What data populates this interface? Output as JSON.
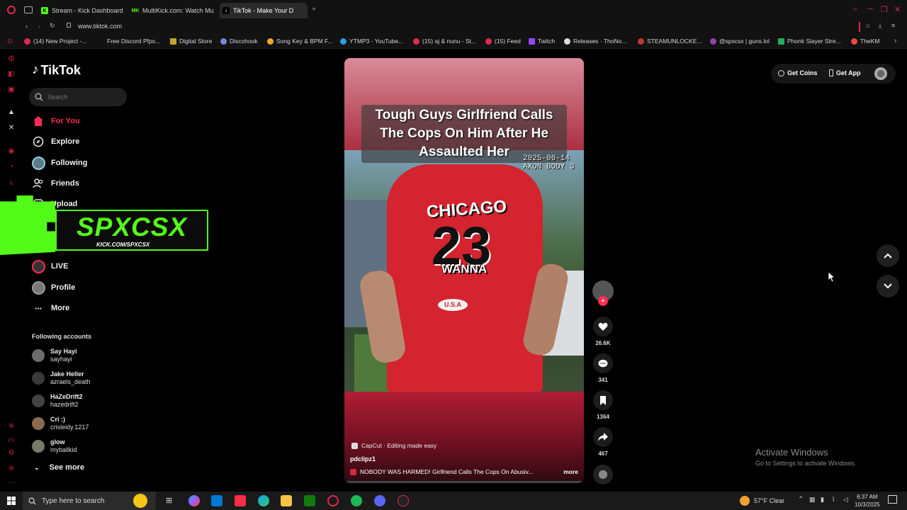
{
  "browser": {
    "tabs": [
      {
        "label": "Stream - Kick Dashboard",
        "fav": "K",
        "color": "#53fc18"
      },
      {
        "label": "MultiKick.com: Watch Mu",
        "fav": "MK",
        "color": "#53fc18"
      },
      {
        "label": "TikTok - Make Your D",
        "fav": "♪",
        "color": "#ffffff"
      }
    ],
    "url": "www.tiktok.com",
    "bookmarks": [
      "(14) New Project -...",
      "Free Discord Pfps...",
      "Digital Store",
      "Discohook",
      "Song Key & BPM F...",
      "YTMP3 - YouTube...",
      "(15) aj & nunu - St...",
      "(15) Feed",
      "Twitch",
      "Releases · ThoNo...",
      "STEAMUNLOCKE...",
      "@spxcsx | guns.lol",
      "Phonk Slayer Stre...",
      "TheKM"
    ]
  },
  "tiktok": {
    "logo": "TikTok",
    "search_placeholder": "Search",
    "nav": {
      "for_you": "For You",
      "explore": "Explore",
      "following": "Following",
      "friends": "Friends",
      "upload": "Upload",
      "live": "LIVE",
      "profile": "Profile",
      "more": "More"
    },
    "following_header": "Following accounts",
    "following_accounts": [
      {
        "name": "Say Hayi",
        "user": "sayhayi"
      },
      {
        "name": "Jake Heller",
        "user": "azraels_death"
      },
      {
        "name": "HaZeDrift2",
        "user": "hazedrift2"
      },
      {
        "name": "Cri :)",
        "user": "crisleidy.1217"
      },
      {
        "name": "glow",
        "user": "myballkid"
      }
    ],
    "see_more": "See more",
    "get_coins": "Get Coins",
    "get_app": "Get App"
  },
  "overlay": {
    "name": "SPXCSX",
    "url": "KICK.COM/SPXCSX"
  },
  "video": {
    "title_line1": "Tough Guys Girlfriend Calls",
    "title_line2": "The Cops On Him After He",
    "title_line3": "Assaulted Her",
    "timestamp_line1": "2025-06-14",
    "timestamp_line2": "AXON BODY 3",
    "shirt_text": "CHICAGO",
    "shirt_number": "23",
    "shirt_badge": "U.S.A",
    "caption_word": "WANNA",
    "capcut": "CapCut · Editing made easy",
    "author": "pdclipz1",
    "description": "NOBODY WAS HARMED! Girlfriend Calls The Cops On Abusiv...",
    "more": "more"
  },
  "actions": {
    "likes": "26.6K",
    "comments": "341",
    "saves": "1364",
    "shares": "467"
  },
  "windows": {
    "activate_title": "Activate Windows",
    "activate_sub": "Go to Settings to activate Windows."
  },
  "taskbar": {
    "search": "Type here to search",
    "weather": "57°F  Clear",
    "time": "6:37 AM",
    "date": "10/3/2025"
  },
  "colors": {
    "tiktok_red": "#fe2c55",
    "kick_green": "#53fc18",
    "opera_red": "#c8223c"
  }
}
